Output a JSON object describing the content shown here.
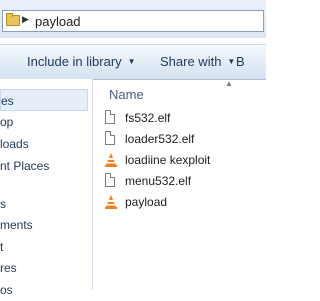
{
  "address": {
    "path": "payload",
    "separator": "▶"
  },
  "toolbar": {
    "include_in_library": "Include in library",
    "share_with": "Share with",
    "burn": "B"
  },
  "nav": {
    "items": [
      "es",
      "op",
      "loads",
      "nt Places",
      "s",
      "ments",
      "t",
      "res",
      "os"
    ]
  },
  "list": {
    "header": "Name",
    "files": [
      {
        "name": "fs532.elf",
        "icon": "file-icon"
      },
      {
        "name": "loader532.elf",
        "icon": "file-icon"
      },
      {
        "name": "loadiine kexploit",
        "icon": "vlc-icon"
      },
      {
        "name": "menu532.elf",
        "icon": "file-icon"
      },
      {
        "name": "payload",
        "icon": "vlc-icon"
      }
    ]
  },
  "colors": {
    "accent": "#1e395b",
    "vlc_orange": "#f58220"
  }
}
